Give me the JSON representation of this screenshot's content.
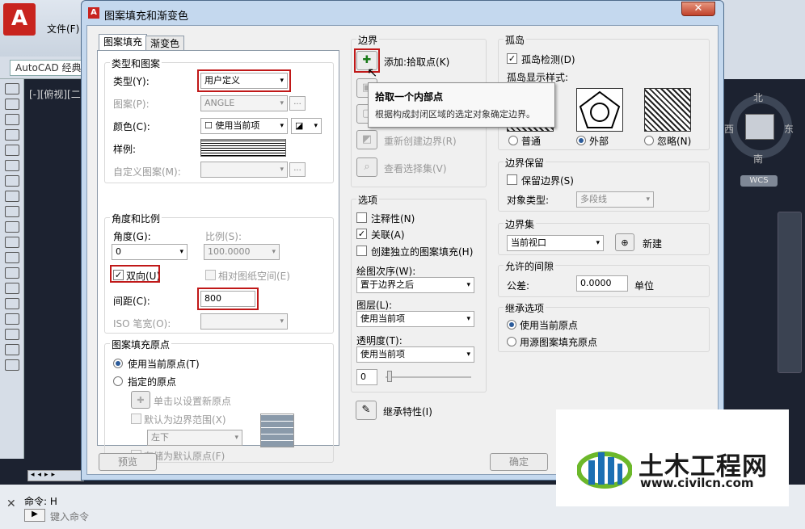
{
  "app": {
    "menu_file": "文件(F)",
    "workspace": "AutoCAD 经典",
    "view_label": "[-][俯视][二",
    "compass": {
      "n": "北",
      "s": "南",
      "e": "东",
      "w": "西"
    },
    "wcs": "WCS",
    "command_label": "命令: H",
    "command_placeholder": "键入命令",
    "cmd_close": "✕",
    "cmd_icon": "▶",
    "layout_tabs": "◂◂▸▸",
    "logo_letter": "A"
  },
  "dialog": {
    "title": "图案填充和渐变色",
    "close": "✕",
    "tabs": [
      "图案填充",
      "渐变色"
    ],
    "type_pattern": {
      "group": "类型和图案",
      "type_label": "类型(Y):",
      "type_value": "用户定义",
      "pattern_label": "图案(P):",
      "pattern_value": "ANGLE",
      "color_label": "颜色(C):",
      "color_value": "使用当前项",
      "color_sub": "☐",
      "swatch_label": "样例:",
      "custom_label": "自定义图案(M):",
      "browse": "..."
    },
    "angle_scale": {
      "group": "角度和比例",
      "angle_label": "角度(G):",
      "angle_value": "0",
      "scale_label": "比例(S):",
      "scale_value": "100.0000",
      "double_label": "双向(U)",
      "paper_label": "相对图纸空间(E)",
      "spacing_label": "间距(C):",
      "spacing_value": "800",
      "iso_label": "ISO 笔宽(O):"
    },
    "origin": {
      "group": "图案填充原点",
      "current_label": "使用当前原点(T)",
      "specified_label": "指定的原点",
      "click_set": "单击以设置新原点",
      "default_extents": "默认为边界范围(X)",
      "extents_value": "左下",
      "store_default": "存储为默认原点(F)"
    },
    "boundary": {
      "group": "边界",
      "add_pick": "添加:拾取点(K)",
      "recreate": "重新创建边界(R)",
      "view_sel": "查看选择集(V)"
    },
    "tooltip": {
      "title": "拾取一个内部点",
      "desc": "根据构成封闭区域的选定对象确定边界。"
    },
    "options": {
      "group": "选项",
      "annotative": "注释性(N)",
      "associative": "关联(A)",
      "separate": "创建独立的图案填充(H)",
      "draw_order_label": "绘图次序(W):",
      "draw_order_value": "置于边界之后",
      "layer_label": "图层(L):",
      "layer_value": "使用当前项",
      "transparency_label": "透明度(T):",
      "transparency_value": "使用当前项",
      "transparency_num": "0"
    },
    "inherit": "继承特性(I)",
    "islands": {
      "group": "孤岛",
      "detect": "孤岛检测(D)",
      "style_label": "孤岛显示样式:",
      "normal": "普通",
      "outer": "外部",
      "ignore": "忽略(N)"
    },
    "retain": {
      "group": "边界保留",
      "retain_label": "保留边界(S)",
      "obj_type_label": "对象类型:",
      "obj_type_value": "多段线"
    },
    "boundary_set": {
      "group": "边界集",
      "value": "当前视口",
      "new": "新建"
    },
    "gap": {
      "group": "允许的间隙",
      "tolerance_label": "公差:",
      "tolerance_value": "0.0000",
      "unit": "单位"
    },
    "inherit_opts": {
      "group": "继承选项",
      "current": "使用当前原点",
      "source": "用源图案填充原点"
    },
    "preview_btn": "预览",
    "ok_btn": "确定"
  },
  "watermark": {
    "name": "土木工程网",
    "url": "www.civilcn.com"
  },
  "colors": {
    "highlight": "#c01818",
    "title_bg": "#c4d8ee",
    "close_btn": "#c0422b"
  },
  "icons": {
    "dropdown": "▾",
    "check": "✓"
  }
}
